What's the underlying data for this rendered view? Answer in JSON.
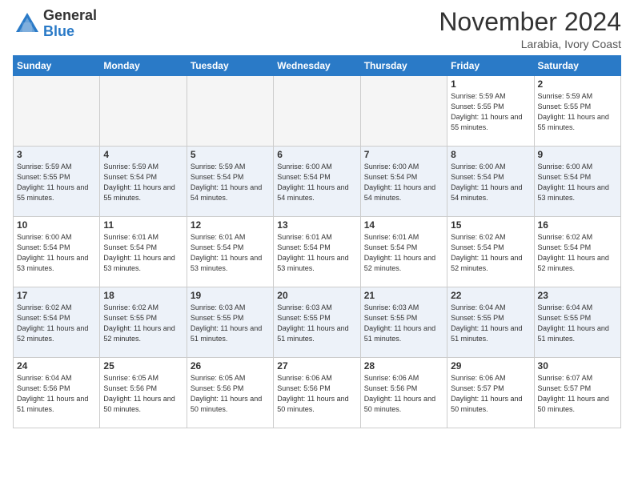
{
  "header": {
    "logo_general": "General",
    "logo_blue": "Blue",
    "month_title": "November 2024",
    "location": "Larabia, Ivory Coast"
  },
  "days_of_week": [
    "Sunday",
    "Monday",
    "Tuesday",
    "Wednesday",
    "Thursday",
    "Friday",
    "Saturday"
  ],
  "weeks": [
    [
      {
        "day": "",
        "empty": true
      },
      {
        "day": "",
        "empty": true
      },
      {
        "day": "",
        "empty": true
      },
      {
        "day": "",
        "empty": true
      },
      {
        "day": "",
        "empty": true
      },
      {
        "day": "1",
        "sunrise": "Sunrise: 5:59 AM",
        "sunset": "Sunset: 5:55 PM",
        "daylight": "Daylight: 11 hours and 55 minutes."
      },
      {
        "day": "2",
        "sunrise": "Sunrise: 5:59 AM",
        "sunset": "Sunset: 5:55 PM",
        "daylight": "Daylight: 11 hours and 55 minutes."
      }
    ],
    [
      {
        "day": "3",
        "sunrise": "Sunrise: 5:59 AM",
        "sunset": "Sunset: 5:55 PM",
        "daylight": "Daylight: 11 hours and 55 minutes."
      },
      {
        "day": "4",
        "sunrise": "Sunrise: 5:59 AM",
        "sunset": "Sunset: 5:54 PM",
        "daylight": "Daylight: 11 hours and 55 minutes."
      },
      {
        "day": "5",
        "sunrise": "Sunrise: 5:59 AM",
        "sunset": "Sunset: 5:54 PM",
        "daylight": "Daylight: 11 hours and 54 minutes."
      },
      {
        "day": "6",
        "sunrise": "Sunrise: 6:00 AM",
        "sunset": "Sunset: 5:54 PM",
        "daylight": "Daylight: 11 hours and 54 minutes."
      },
      {
        "day": "7",
        "sunrise": "Sunrise: 6:00 AM",
        "sunset": "Sunset: 5:54 PM",
        "daylight": "Daylight: 11 hours and 54 minutes."
      },
      {
        "day": "8",
        "sunrise": "Sunrise: 6:00 AM",
        "sunset": "Sunset: 5:54 PM",
        "daylight": "Daylight: 11 hours and 54 minutes."
      },
      {
        "day": "9",
        "sunrise": "Sunrise: 6:00 AM",
        "sunset": "Sunset: 5:54 PM",
        "daylight": "Daylight: 11 hours and 53 minutes."
      }
    ],
    [
      {
        "day": "10",
        "sunrise": "Sunrise: 6:00 AM",
        "sunset": "Sunset: 5:54 PM",
        "daylight": "Daylight: 11 hours and 53 minutes."
      },
      {
        "day": "11",
        "sunrise": "Sunrise: 6:01 AM",
        "sunset": "Sunset: 5:54 PM",
        "daylight": "Daylight: 11 hours and 53 minutes."
      },
      {
        "day": "12",
        "sunrise": "Sunrise: 6:01 AM",
        "sunset": "Sunset: 5:54 PM",
        "daylight": "Daylight: 11 hours and 53 minutes."
      },
      {
        "day": "13",
        "sunrise": "Sunrise: 6:01 AM",
        "sunset": "Sunset: 5:54 PM",
        "daylight": "Daylight: 11 hours and 53 minutes."
      },
      {
        "day": "14",
        "sunrise": "Sunrise: 6:01 AM",
        "sunset": "Sunset: 5:54 PM",
        "daylight": "Daylight: 11 hours and 52 minutes."
      },
      {
        "day": "15",
        "sunrise": "Sunrise: 6:02 AM",
        "sunset": "Sunset: 5:54 PM",
        "daylight": "Daylight: 11 hours and 52 minutes."
      },
      {
        "day": "16",
        "sunrise": "Sunrise: 6:02 AM",
        "sunset": "Sunset: 5:54 PM",
        "daylight": "Daylight: 11 hours and 52 minutes."
      }
    ],
    [
      {
        "day": "17",
        "sunrise": "Sunrise: 6:02 AM",
        "sunset": "Sunset: 5:54 PM",
        "daylight": "Daylight: 11 hours and 52 minutes."
      },
      {
        "day": "18",
        "sunrise": "Sunrise: 6:02 AM",
        "sunset": "Sunset: 5:55 PM",
        "daylight": "Daylight: 11 hours and 52 minutes."
      },
      {
        "day": "19",
        "sunrise": "Sunrise: 6:03 AM",
        "sunset": "Sunset: 5:55 PM",
        "daylight": "Daylight: 11 hours and 51 minutes."
      },
      {
        "day": "20",
        "sunrise": "Sunrise: 6:03 AM",
        "sunset": "Sunset: 5:55 PM",
        "daylight": "Daylight: 11 hours and 51 minutes."
      },
      {
        "day": "21",
        "sunrise": "Sunrise: 6:03 AM",
        "sunset": "Sunset: 5:55 PM",
        "daylight": "Daylight: 11 hours and 51 minutes."
      },
      {
        "day": "22",
        "sunrise": "Sunrise: 6:04 AM",
        "sunset": "Sunset: 5:55 PM",
        "daylight": "Daylight: 11 hours and 51 minutes."
      },
      {
        "day": "23",
        "sunrise": "Sunrise: 6:04 AM",
        "sunset": "Sunset: 5:55 PM",
        "daylight": "Daylight: 11 hours and 51 minutes."
      }
    ],
    [
      {
        "day": "24",
        "sunrise": "Sunrise: 6:04 AM",
        "sunset": "Sunset: 5:56 PM",
        "daylight": "Daylight: 11 hours and 51 minutes."
      },
      {
        "day": "25",
        "sunrise": "Sunrise: 6:05 AM",
        "sunset": "Sunset: 5:56 PM",
        "daylight": "Daylight: 11 hours and 50 minutes."
      },
      {
        "day": "26",
        "sunrise": "Sunrise: 6:05 AM",
        "sunset": "Sunset: 5:56 PM",
        "daylight": "Daylight: 11 hours and 50 minutes."
      },
      {
        "day": "27",
        "sunrise": "Sunrise: 6:06 AM",
        "sunset": "Sunset: 5:56 PM",
        "daylight": "Daylight: 11 hours and 50 minutes."
      },
      {
        "day": "28",
        "sunrise": "Sunrise: 6:06 AM",
        "sunset": "Sunset: 5:56 PM",
        "daylight": "Daylight: 11 hours and 50 minutes."
      },
      {
        "day": "29",
        "sunrise": "Sunrise: 6:06 AM",
        "sunset": "Sunset: 5:57 PM",
        "daylight": "Daylight: 11 hours and 50 minutes."
      },
      {
        "day": "30",
        "sunrise": "Sunrise: 6:07 AM",
        "sunset": "Sunset: 5:57 PM",
        "daylight": "Daylight: 11 hours and 50 minutes."
      }
    ]
  ]
}
